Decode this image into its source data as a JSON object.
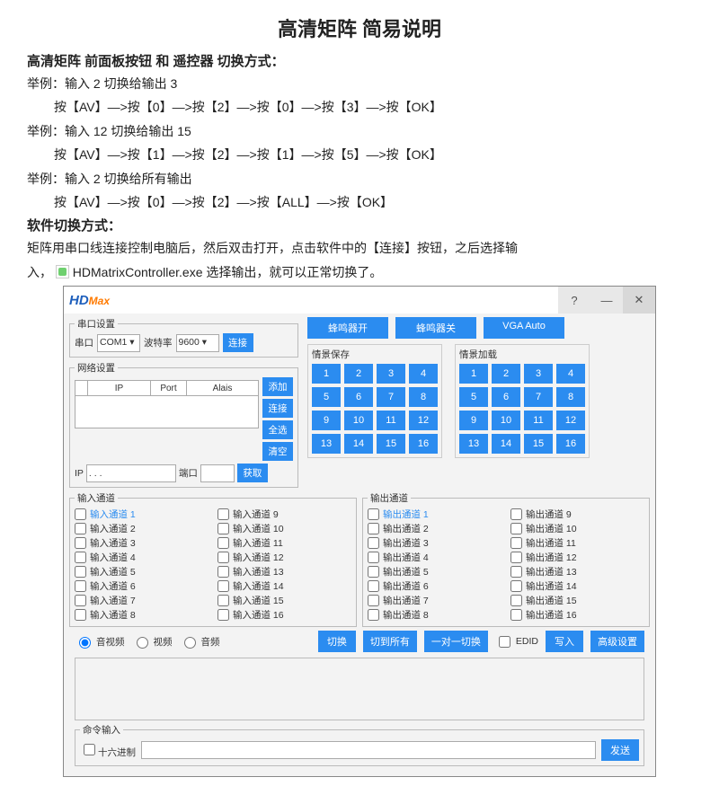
{
  "doc": {
    "title": "高清矩阵  简易说明",
    "heading_panel": "高清矩阵 前面板按钮 和 遥控器 切换方式：",
    "ex1_label": "举例：输入 2 切换给输出 3",
    "ex1_seq": "按【AV】—>按【0】—>按【2】—>按【0】—>按【3】—>按【OK】",
    "ex2_label": "举例：输入 12 切换给输出 15",
    "ex2_seq": "按【AV】—>按【1】—>按【2】—>按【1】—>按【5】—>按【OK】",
    "ex3_label": "举例：输入 2 切换给所有输出",
    "ex3_seq": "按【AV】—>按【0】—>按【2】—>按【ALL】—>按【OK】",
    "heading_software": "软件切换方式：",
    "software_line1": "矩阵用串口线连接控制电脑后，然后双击打开，点击软件中的【连接】按钮，之后选择输",
    "software_line2_pre": "入，",
    "exe_name": " HDMatrixController.exe",
    "software_line2_post": "   选择输出，就可以正常切换了。"
  },
  "app": {
    "logo_hd": "HD",
    "logo_max": "Max",
    "serial": {
      "legend": "串口设置",
      "label_port": "串口",
      "port_value": "COM1",
      "label_baud": "波特率",
      "baud_value": "9600",
      "connect": "连接"
    },
    "net": {
      "legend": "网络设置",
      "col_ip": "IP",
      "col_port": "Port",
      "col_alias": "Alais",
      "btn_add": "添加",
      "btn_connect": "连接",
      "btn_selectall": "全选",
      "btn_clear": "清空",
      "label_ip": "IP",
      "ip_value": " .   .   .  ",
      "label_port": "端口",
      "btn_get": "获取"
    },
    "top_buttons": {
      "buzzer_on": "蜂鸣器开",
      "buzzer_off": "蜂鸣器关",
      "vga_auto": "VGA Auto"
    },
    "scene_save_label": "情景保存",
    "scene_load_label": "情景加载",
    "scene_numbers": [
      "1",
      "2",
      "3",
      "4",
      "5",
      "6",
      "7",
      "8",
      "9",
      "10",
      "11",
      "12",
      "13",
      "14",
      "15",
      "16"
    ],
    "input": {
      "legend": "输入通道",
      "items": [
        "输入通道 1",
        "输入通道 2",
        "输入通道 3",
        "输入通道 4",
        "输入通道 5",
        "输入通道 6",
        "输入通道 7",
        "输入通道 8",
        "输入通道 9",
        "输入通道 10",
        "输入通道 11",
        "输入通道 12",
        "输入通道 13",
        "输入通道 14",
        "输入通道 15",
        "输入通道 16"
      ]
    },
    "output": {
      "legend": "输出通道",
      "items": [
        "输出通道 1",
        "输出通道 2",
        "输出通道 3",
        "输出通道 4",
        "输出通道 5",
        "输出通道 6",
        "输出通道 7",
        "输出通道 8",
        "输出通道 9",
        "输出通道 10",
        "输出通道 11",
        "输出通道 12",
        "输出通道 13",
        "输出通道 14",
        "输出通道 15",
        "输出通道 16"
      ]
    },
    "radios": {
      "av": "音视频",
      "video": "视频",
      "audio": "音频"
    },
    "action_buttons": {
      "switch": "切换",
      "switch_all": "切到所有",
      "one_to_one": "一对一切换",
      "edid": "EDID",
      "write": "写入",
      "advanced": "高级设置"
    },
    "cmd": {
      "legend": "命令输入",
      "hex": "十六进制",
      "send": "发送"
    }
  }
}
